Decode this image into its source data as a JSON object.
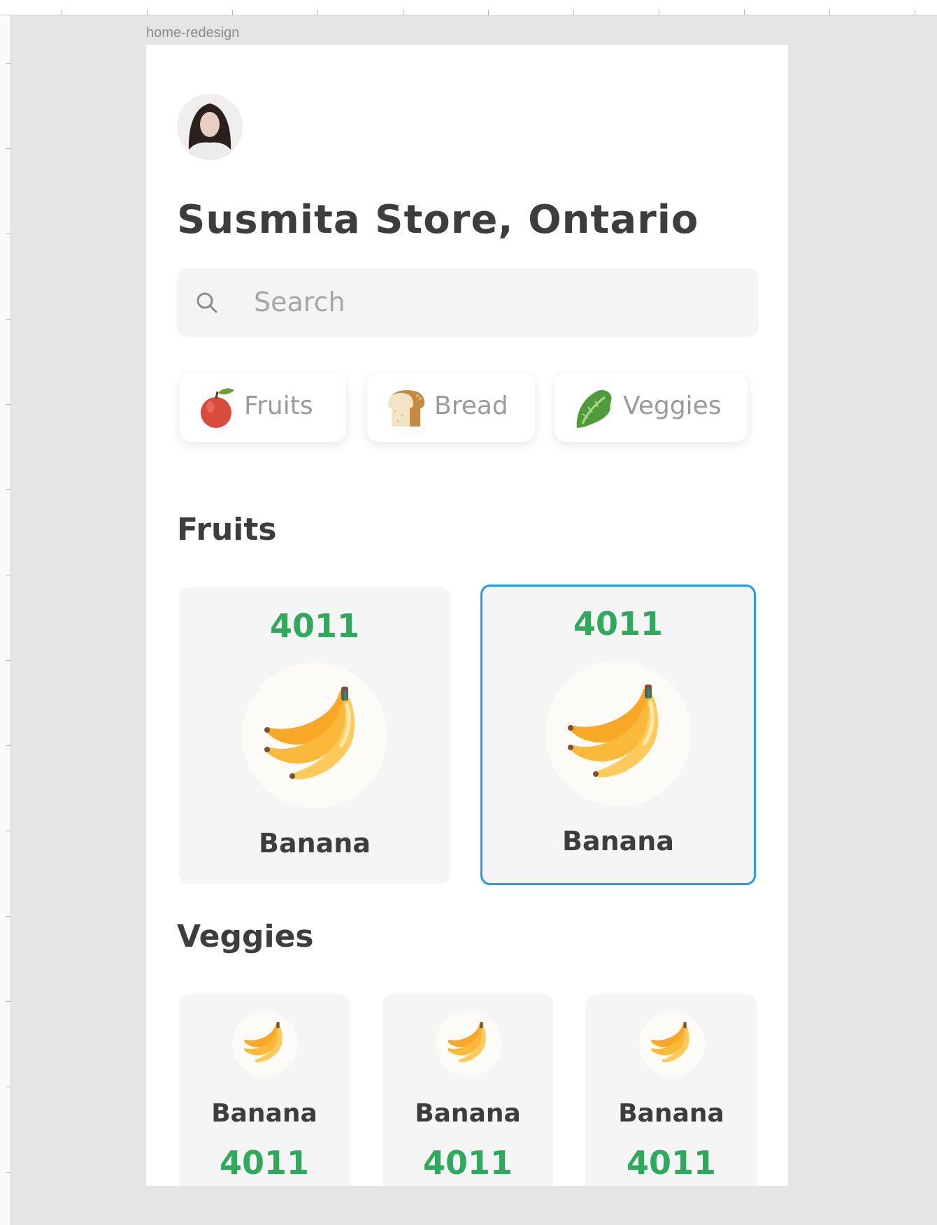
{
  "artboard": {
    "name": "home-redesign"
  },
  "store": {
    "title": "Susmita Store, Ontario"
  },
  "search": {
    "placeholder": "Search",
    "icon": "search-icon"
  },
  "categories": [
    {
      "label": "Fruits",
      "icon": "apple-icon"
    },
    {
      "label": "Bread",
      "icon": "bread-icon"
    },
    {
      "label": "Veggies",
      "icon": "lettuce-icon"
    }
  ],
  "sections": {
    "fruits": {
      "title": "Fruits",
      "items": [
        {
          "code": "4011",
          "name": "Banana",
          "icon": "banana-icon",
          "selected": false
        },
        {
          "code": "4011",
          "name": "Banana",
          "icon": "banana-icon",
          "selected": true
        }
      ]
    },
    "veggies": {
      "title": "Veggies",
      "items": [
        {
          "code": "4011",
          "name": "Banana",
          "icon": "banana-icon"
        },
        {
          "code": "4011",
          "name": "Banana",
          "icon": "banana-icon"
        },
        {
          "code": "4011",
          "name": "Banana",
          "icon": "banana-icon"
        }
      ]
    }
  },
  "colors": {
    "accent_green": "#2eaa5c",
    "selection_blue": "#1e9cf0",
    "card_bg": "#f5f5f5",
    "canvas_bg": "#e5e5e5"
  }
}
